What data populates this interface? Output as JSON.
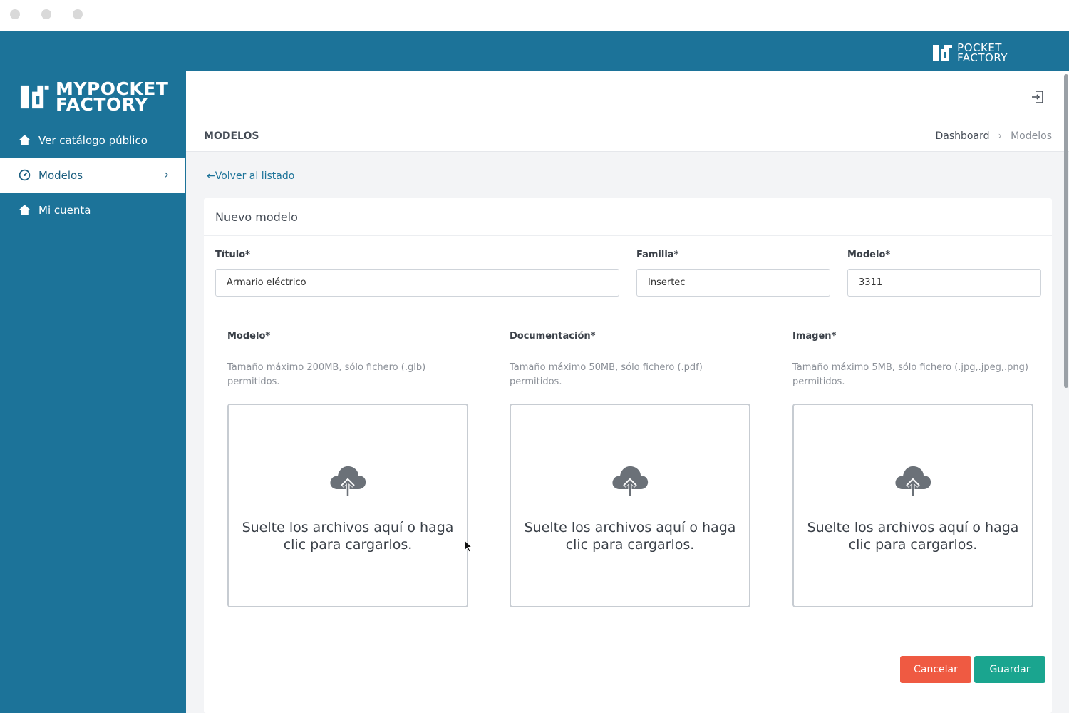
{
  "brand": {
    "top_line1": "POCKET",
    "top_line2": "FACTORY",
    "sidebar_line1": "MYPOCKET",
    "sidebar_line2": "FACTORY"
  },
  "sidebar": {
    "items": [
      {
        "label": "Ver catálogo público",
        "icon": "home-icon"
      },
      {
        "label": "Modelos",
        "icon": "gauge-icon",
        "active": true
      },
      {
        "label": "Mi cuenta",
        "icon": "home-icon"
      }
    ]
  },
  "header": {
    "title": "MODELOS",
    "breadcrumb": [
      "Dashboard",
      "›",
      "Modelos"
    ]
  },
  "back_link": "←Volver al listado",
  "form": {
    "card_title": "Nuevo modelo",
    "titulo": {
      "label": "Título*",
      "value": "Armario eléctrico"
    },
    "familia": {
      "label": "Familia*",
      "value": "Insertec"
    },
    "modelo": {
      "label": "Modelo*",
      "value": "3311"
    }
  },
  "uploads": [
    {
      "label": "Modelo*",
      "help": "Tamaño máximo 200MB, sólo fichero (.glb) permitidos.",
      "drop_text": "Suelte los archivos aquí o haga clic para cargarlos."
    },
    {
      "label": "Documentación*",
      "help": "Tamaño máximo 50MB, sólo fichero (.pdf) permitidos.",
      "drop_text": "Suelte los archivos aquí o haga clic para cargarlos."
    },
    {
      "label": "Imagen*",
      "help": "Tamaño máximo 5MB, sólo fichero (.jpg,.jpeg,.png) permitidos.",
      "drop_text": "Suelte los archivos aquí o haga clic para cargarlos."
    }
  ],
  "buttons": {
    "cancel": "Cancelar",
    "save": "Guardar"
  },
  "colors": {
    "brand_blue": "#1c7399",
    "cancel_red": "#ef5a42",
    "save_teal": "#1aa58f"
  }
}
